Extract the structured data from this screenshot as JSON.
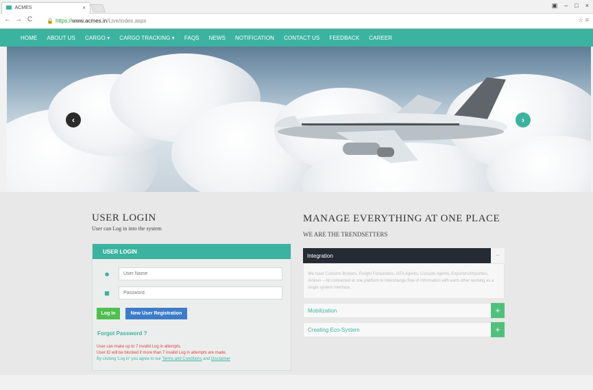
{
  "browser": {
    "tab_title": "ACMES",
    "tab_close": "×",
    "url_proto": "https://",
    "url_host": "www.acmes.in",
    "url_path": "/Live/index.aspx"
  },
  "nav": {
    "items": [
      "HOME",
      "ABOUT US",
      "CARGO ▾",
      "CARGO TRACKING ▾",
      "FAQS",
      "NEWS",
      "NOTIFICATION",
      "CONTACT US",
      "FEEDBACK",
      "CAREER"
    ]
  },
  "login": {
    "title": "USER LOGIN",
    "subtitle": "User can Log in into the system",
    "panel_title": "USER LOGIN",
    "username_placeholder": "User Name",
    "password_placeholder": "Password",
    "login_button": "Log In",
    "register_button": "New User Registration",
    "forgot": "Forgot Password ?",
    "note1": "User can make up to 7 invalid Log in attempts.",
    "note2": "User ID will be blocked if more than 7 invalid Log in attempts are made.",
    "note3_prefix": "By clicking 'Log in' you agree to our ",
    "terms": "Terms and Conditions",
    "and": " and ",
    "disclaimer": "Disclaimer"
  },
  "manage": {
    "title": "MANAGE EVERYTHING AT ONE PLACE",
    "subtitle": "WE ARE THE TRENDSETTERS",
    "acc1_title": "Integration",
    "acc1_toggle": "−",
    "acc1_body": "We have Customs Brokers, Freight Forwarders, IATA Agents, Console Agents, Exporters/Importers, Airlines – All connected at one platform to interchange flow of information with each other working as a single system interface.",
    "acc2_title": "Mobilization",
    "acc3_title": "Creating Eco-System",
    "plus": "+"
  },
  "colors": {
    "accent": "#3bb3a0",
    "dark": "#262b33",
    "green": "#4fbf4f",
    "blue": "#3d7cc9",
    "red": "#e23c3c"
  },
  "icons": {
    "prev": "chevron-left-icon",
    "next": "chevron-right-icon",
    "user": "user-icon",
    "lock": "lock-icon"
  }
}
